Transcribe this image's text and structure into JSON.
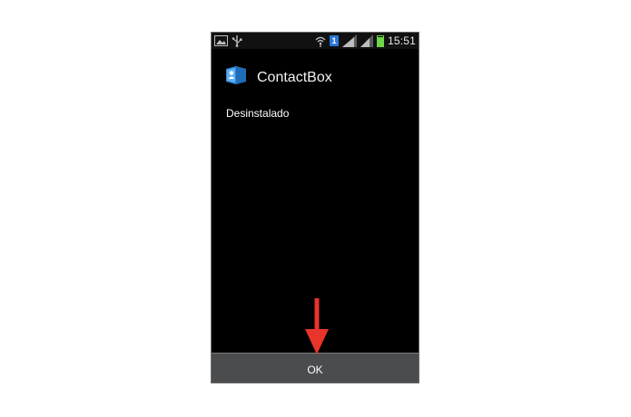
{
  "status_bar": {
    "time": "15:51",
    "sim_number": "1",
    "battery_level": 0.85,
    "icons": [
      "gallery-icon",
      "usb-icon",
      "wifi-icon",
      "sim-icon",
      "signal-icon",
      "signal-icon",
      "battery-icon"
    ]
  },
  "dialog": {
    "app_name": "ContactBox",
    "app_icon": "contactbox-app-icon",
    "message": "Desinstalado",
    "ok_label": "OK"
  },
  "annotation": {
    "arrow_color": "#e8342a",
    "arrow_direction": "down"
  },
  "colors": {
    "screen_bg": "#000000",
    "ok_bar_bg": "#4a4c4d",
    "battery": "#6fd64a",
    "sim_badge": "#2a78d6",
    "app_icon": "#2f86d8"
  }
}
